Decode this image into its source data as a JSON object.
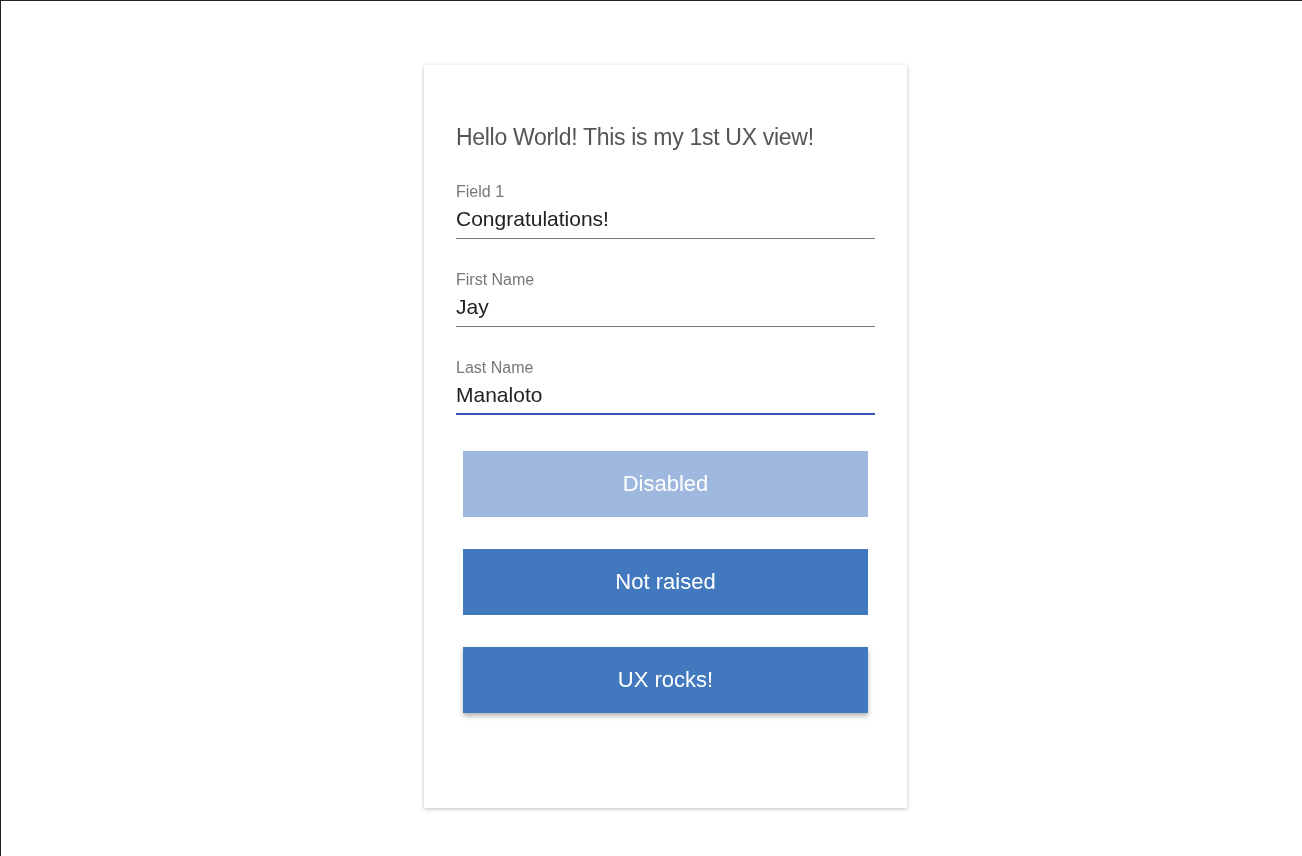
{
  "card": {
    "heading": "Hello World! This is my 1st UX view!",
    "fields": [
      {
        "label": "Field 1",
        "value": "Congratulations!",
        "focused": false
      },
      {
        "label": "First Name",
        "value": "Jay",
        "focused": false
      },
      {
        "label": "Last Name",
        "value": "Manaloto",
        "focused": true
      }
    ],
    "buttons": [
      {
        "label": "Disabled",
        "kind": "disabled"
      },
      {
        "label": "Not raised",
        "kind": "flat"
      },
      {
        "label": "UX rocks!",
        "kind": "raised"
      }
    ]
  }
}
